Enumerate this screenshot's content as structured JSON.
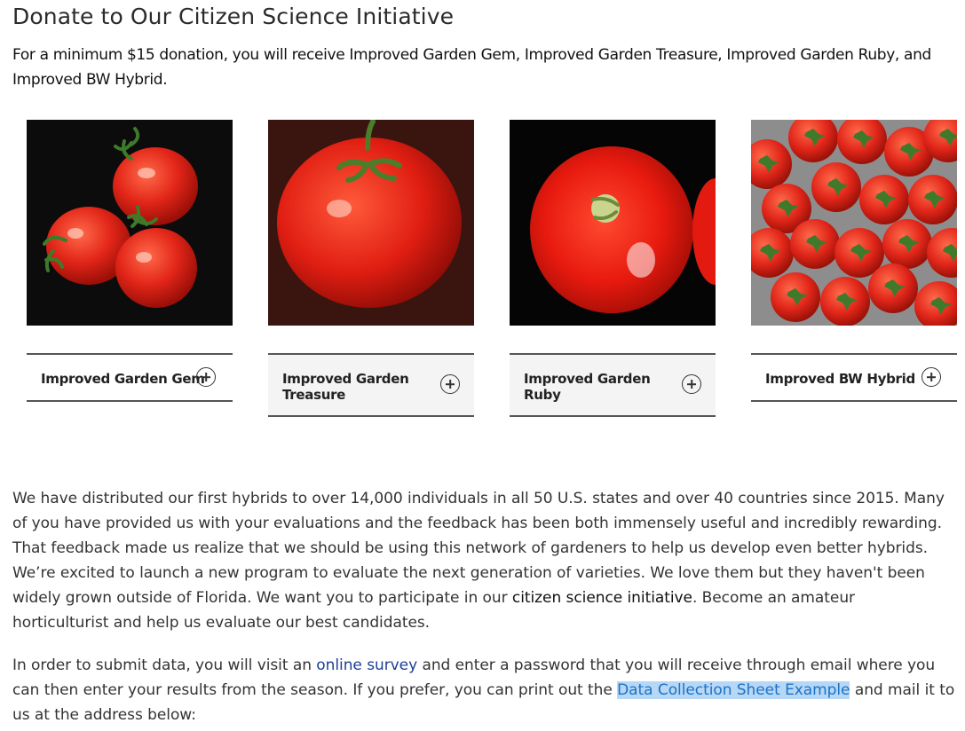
{
  "heading": "Donate to Our Citizen Science Initiative",
  "subheading": "For a minimum $15 donation, you will receive Improved Garden Gem, Improved Garden Treasure, Improved Garden Ruby, and Improved BW Hybrid.",
  "varieties": [
    {
      "name": "Improved Garden Gem",
      "icon": "plus-circle-icon"
    },
    {
      "name": "Improved Garden Treasure",
      "icon": "plus-circle-icon"
    },
    {
      "name": "Improved Garden Ruby",
      "icon": "plus-circle-icon"
    },
    {
      "name": "Improved BW Hybrid",
      "icon": "plus-circle-icon"
    }
  ],
  "paragraph1": {
    "before_link": "We have distributed our first hybrids to over 14,000 individuals in all 50 U.S. states and over 40 countries since 2015. Many of you have provided us with your evaluations and the feedback has been both immensely useful and incredibly rewarding. That feedback made us realize that we should be using this network of gardeners to help us develop even better hybrids. We’re excited to launch a new program to evaluate the next generation of varieties. We love them but they haven't been widely grown outside of Florida. We want you to participate in our ",
    "link": "citizen science initiative",
    "after_link": ". Become an amateur horticulturist and help us evaluate our best candidates."
  },
  "paragraph2": {
    "part1": "In order to submit data, you will visit an ",
    "survey_link": "online survey",
    "part2": " and enter a password that you will receive through email where you can then enter your results from the season. If you prefer, you can print out the ",
    "sheet_link": "Data Collection Sheet Example",
    "part3": " and mail it to us at the address below:"
  },
  "colors": {
    "link_blue": "#1c3f95",
    "highlight_bg": "#b6d7f5",
    "highlight_text": "#1a73c8",
    "tomato_red": "#e32619"
  }
}
